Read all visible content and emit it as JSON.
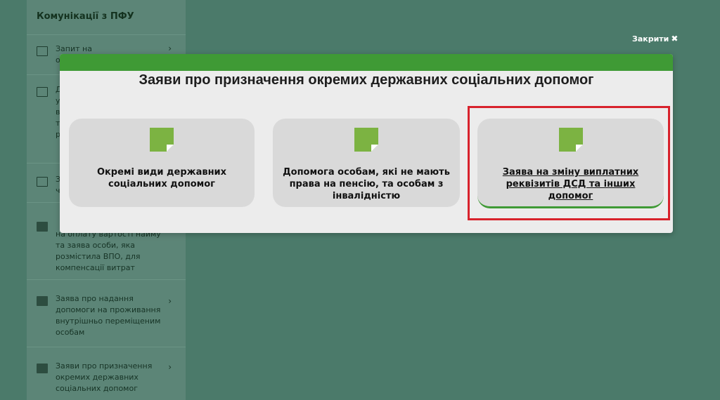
{
  "sidebar": {
    "title": "Комунікації з ПФУ",
    "items": [
      {
        "label": "Запит на отримання е",
        "icon": "checkbox-icon"
      },
      {
        "label": "Д\nу\nв\nт\nр",
        "icon": "envelope-icon"
      },
      {
        "label": "З\nч",
        "icon": "envelope-icon"
      },
      {
        "label": "на оплату вартості найму та заява особи, яка розмістила ВПО, для компенсації витрат",
        "icon": "folder-icon"
      },
      {
        "label": "Заява про надання допомоги на проживання внутрішньо переміщеним особам",
        "icon": "folder-icon"
      },
      {
        "label": "Заяви про призначення окремих державних соціальних допомог",
        "icon": "folder-icon"
      }
    ],
    "chevron": "›"
  },
  "overlay": {
    "close_label": "Закрити",
    "close_glyph": "✖"
  },
  "modal": {
    "title": "Заяви про призначення окремих державних соціальних допомог",
    "cards": [
      {
        "label": "Окремі види державних соціальних допомог",
        "icon": "document-icon"
      },
      {
        "label": "Допомога особам, які не мають права на пенсію, та особам з інвалідністю",
        "icon": "document-icon"
      },
      {
        "label": "Заява на зміну виплатних реквізитів ДСД та інших допомог",
        "icon": "document-icon"
      }
    ],
    "accent_color": "#3f9a35",
    "highlight_color": "#d8222c"
  }
}
